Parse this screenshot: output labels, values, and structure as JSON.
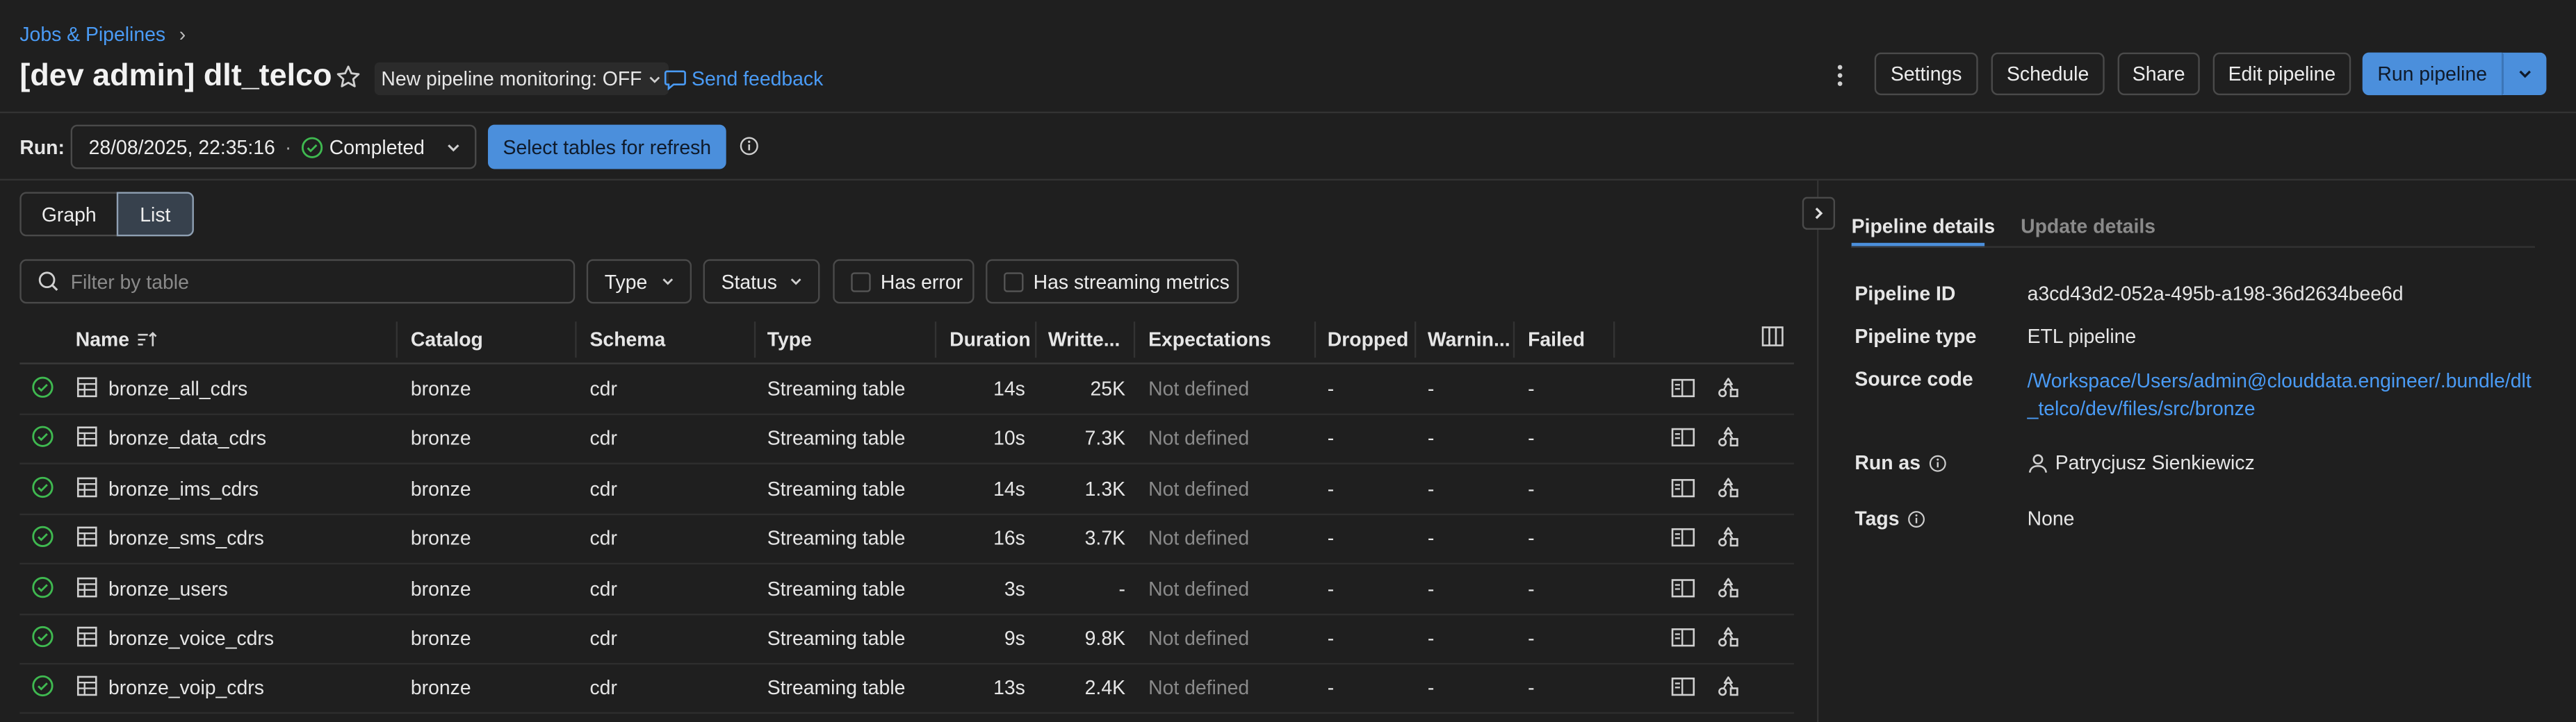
{
  "breadcrumb": {
    "parent": "Jobs & Pipelines",
    "separator": "›"
  },
  "header": {
    "title": "[dev admin] dlt_telco",
    "monitoring_label": "New pipeline monitoring: OFF",
    "feedback_label": "Send feedback",
    "buttons": {
      "settings": "Settings",
      "schedule": "Schedule",
      "share": "Share",
      "edit": "Edit pipeline",
      "run": "Run pipeline"
    }
  },
  "run": {
    "label": "Run:",
    "datetime": "28/08/2025, 22:35:16",
    "dot": "·",
    "status": "Completed",
    "refresh_button": "Select tables for refresh"
  },
  "view_tabs": {
    "graph": "Graph",
    "list": "List",
    "selected": "List"
  },
  "filters": {
    "search_placeholder": "Filter by table",
    "type": "Type",
    "status": "Status",
    "has_error": "Has error",
    "has_streaming_metrics": "Has streaming metrics"
  },
  "table": {
    "columns": [
      "Name",
      "Catalog",
      "Schema",
      "Type",
      "Duration",
      "Writte...",
      "Expectations",
      "Dropped",
      "Warnin...",
      "Failed"
    ],
    "rows": [
      {
        "name": "bronze_all_cdrs",
        "catalog": "bronze",
        "schema": "cdr",
        "type": "Streaming table",
        "duration": "14s",
        "written": "25K",
        "expectations": "Not defined",
        "dropped": "-",
        "warning": "-",
        "failed": "-"
      },
      {
        "name": "bronze_data_cdrs",
        "catalog": "bronze",
        "schema": "cdr",
        "type": "Streaming table",
        "duration": "10s",
        "written": "7.3K",
        "expectations": "Not defined",
        "dropped": "-",
        "warning": "-",
        "failed": "-"
      },
      {
        "name": "bronze_ims_cdrs",
        "catalog": "bronze",
        "schema": "cdr",
        "type": "Streaming table",
        "duration": "14s",
        "written": "1.3K",
        "expectations": "Not defined",
        "dropped": "-",
        "warning": "-",
        "failed": "-"
      },
      {
        "name": "bronze_sms_cdrs",
        "catalog": "bronze",
        "schema": "cdr",
        "type": "Streaming table",
        "duration": "16s",
        "written": "3.7K",
        "expectations": "Not defined",
        "dropped": "-",
        "warning": "-",
        "failed": "-"
      },
      {
        "name": "bronze_users",
        "catalog": "bronze",
        "schema": "cdr",
        "type": "Streaming table",
        "duration": "3s",
        "written": "-",
        "expectations": "Not defined",
        "dropped": "-",
        "warning": "-",
        "failed": "-"
      },
      {
        "name": "bronze_voice_cdrs",
        "catalog": "bronze",
        "schema": "cdr",
        "type": "Streaming table",
        "duration": "9s",
        "written": "9.8K",
        "expectations": "Not defined",
        "dropped": "-",
        "warning": "-",
        "failed": "-"
      },
      {
        "name": "bronze_voip_cdrs",
        "catalog": "bronze",
        "schema": "cdr",
        "type": "Streaming table",
        "duration": "13s",
        "written": "2.4K",
        "expectations": "Not defined",
        "dropped": "-",
        "warning": "-",
        "failed": "-"
      }
    ]
  },
  "details": {
    "tabs": {
      "pipeline": "Pipeline details",
      "update": "Update details"
    },
    "pipeline_id_label": "Pipeline ID",
    "pipeline_id": "a3cd43d2-052a-495b-a198-36d2634bee6d",
    "pipeline_type_label": "Pipeline type",
    "pipeline_type": "ETL pipeline",
    "source_code_label": "Source code",
    "source_code_line1": "/Workspace/Users/admin@clouddata.engineer/.bundle/dlt",
    "source_code_line2": "_telco/dev/files/src/bronze",
    "run_as_label": "Run as",
    "run_as": "Patrycjusz Sienkiewicz",
    "tags_label": "Tags",
    "tags": "None"
  },
  "colors": {
    "accent": "#4b8fdc",
    "success": "#3fb950",
    "link": "#4a9bf5"
  },
  "icons": [
    "star-icon",
    "chevron-down-icon",
    "feedback-icon",
    "kebab-menu-icon",
    "check-circle-icon",
    "info-icon",
    "search-icon",
    "sort-icon",
    "columns-icon",
    "table-icon",
    "lineage-icon",
    "chevron-right-icon",
    "user-icon"
  ]
}
